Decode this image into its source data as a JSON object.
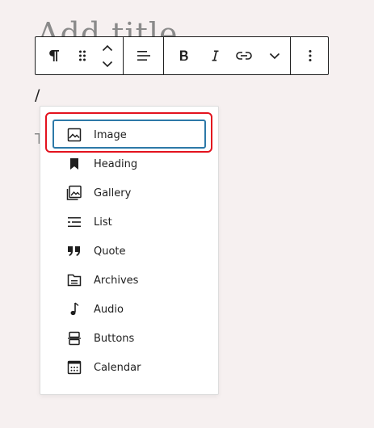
{
  "editor": {
    "title_placeholder": "Add title",
    "slash_text": "/",
    "background_letter": "T"
  },
  "toolbar": {
    "paragraph_icon": "paragraph-icon",
    "drag_icon": "drag-handle-icon",
    "move_up_icon": "chevron-up-icon",
    "move_down_icon": "chevron-down-icon",
    "align_icon": "align-left-icon",
    "bold_icon": "bold-icon",
    "italic_icon": "italic-icon",
    "link_icon": "link-icon",
    "more_rich_icon": "chevron-down-icon",
    "options_icon": "more-vertical-icon"
  },
  "block_inserter": {
    "items": [
      {
        "label": "Image",
        "icon": "image-icon",
        "selected": true
      },
      {
        "label": "Heading",
        "icon": "bookmark-icon"
      },
      {
        "label": "Gallery",
        "icon": "gallery-icon"
      },
      {
        "label": "List",
        "icon": "list-icon"
      },
      {
        "label": "Quote",
        "icon": "quote-icon"
      },
      {
        "label": "Archives",
        "icon": "archive-icon"
      },
      {
        "label": "Audio",
        "icon": "music-note-icon"
      },
      {
        "label": "Buttons",
        "icon": "buttons-icon"
      },
      {
        "label": "Calendar",
        "icon": "calendar-icon"
      }
    ]
  },
  "colors": {
    "background": "#f6f0f0",
    "selection_outline": "#2d79a8",
    "annotation_highlight": "#e3121e"
  }
}
